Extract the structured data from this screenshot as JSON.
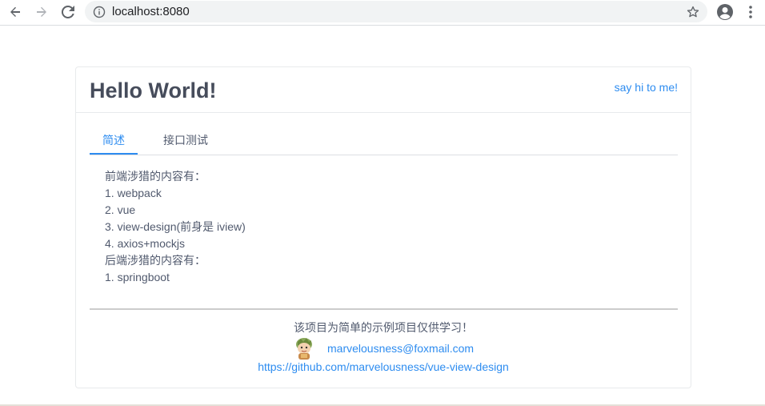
{
  "browser": {
    "url": "localhost:8080",
    "icons": [
      "back-arrow-icon",
      "forward-arrow-icon",
      "reload-icon",
      "info-icon",
      "star-icon",
      "account-icon",
      "kebab-menu-icon"
    ]
  },
  "card": {
    "title": "Hello World!",
    "say_hi": "say hi to me!"
  },
  "tabs": [
    {
      "label": "简述",
      "active": true
    },
    {
      "label": "接口测试",
      "active": false
    }
  ],
  "content": {
    "lines": [
      "前端涉猎的内容有：",
      "1. webpack",
      "2. vue",
      "3. view-design(前身是 iview)",
      "4. axios+mockjs",
      "后端涉猎的内容有：",
      "1. springboot"
    ]
  },
  "footer": {
    "note": "该项目为简单的示例项目仅供学习！",
    "email": "marvelousness@foxmail.com",
    "repo": "https://github.com/marvelousness/vue-view-design"
  },
  "colors": {
    "accent": "#2d8cf0",
    "text": "#515a6e",
    "title": "#464c5b",
    "border": "#e8eaec"
  }
}
